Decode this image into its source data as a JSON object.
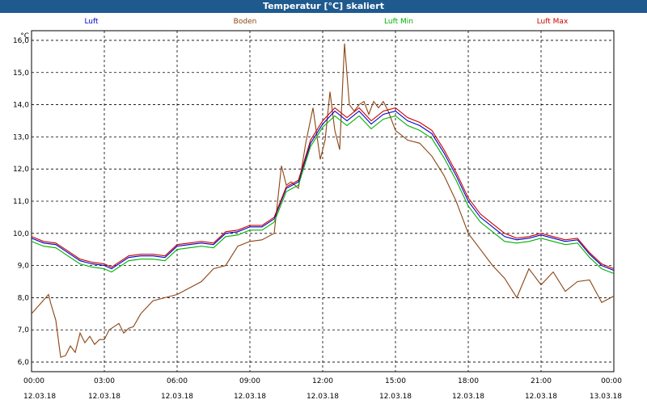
{
  "window": {
    "title": "Temperatur [°C] skaliert"
  },
  "chart_data": {
    "type": "line",
    "title": "Temperatur [°C] skaliert",
    "ylabel": "°C",
    "xlabel": "",
    "ylim": [
      5.7,
      16.3
    ],
    "xlim_hours": [
      0,
      24
    ],
    "y_ticks": [
      "6,0",
      "7,0",
      "8,0",
      "9,0",
      "10,0",
      "11,0",
      "12,0",
      "13,0",
      "14,0",
      "15,0",
      "16,0"
    ],
    "y_tick_values": [
      6,
      7,
      8,
      9,
      10,
      11,
      12,
      13,
      14,
      15,
      16
    ],
    "x_ticks": [
      {
        "time": "00:00",
        "date": "12.03.18"
      },
      {
        "time": "03:00",
        "date": "12.03.18"
      },
      {
        "time": "06:00",
        "date": "12.03.18"
      },
      {
        "time": "09:00",
        "date": "12.03.18"
      },
      {
        "time": "12:00",
        "date": "12.03.18"
      },
      {
        "time": "15:00",
        "date": "12.03.18"
      },
      {
        "time": "18:00",
        "date": "12.03.18"
      },
      {
        "time": "21:00",
        "date": "12.03.18"
      },
      {
        "time": "00:00",
        "date": "13.03.18"
      }
    ],
    "grid": true,
    "legend_position": "top",
    "series": [
      {
        "name": "Luft",
        "color": "#0000cc",
        "x": [
          0,
          0.5,
          1,
          1.5,
          2,
          2.5,
          3,
          3.3,
          3.5,
          4,
          4.5,
          5,
          5.5,
          6,
          6.5,
          7,
          7.5,
          8,
          8.5,
          9,
          9.5,
          10,
          10.5,
          11,
          11.5,
          12,
          12.5,
          13,
          13.5,
          14,
          14.5,
          15,
          15.5,
          16,
          16.5,
          17,
          17.5,
          18,
          18.5,
          19,
          19.5,
          20,
          20.5,
          21,
          21.5,
          22,
          22.5,
          23,
          23.5,
          24
        ],
        "y": [
          9.85,
          9.7,
          9.65,
          9.4,
          9.15,
          9.05,
          9.0,
          8.9,
          9.0,
          9.25,
          9.3,
          9.3,
          9.25,
          9.6,
          9.65,
          9.7,
          9.65,
          10.0,
          10.05,
          10.2,
          10.2,
          10.45,
          11.4,
          11.6,
          12.8,
          13.4,
          13.8,
          13.5,
          13.8,
          13.4,
          13.7,
          13.8,
          13.5,
          13.35,
          13.1,
          12.5,
          11.8,
          11.0,
          10.5,
          10.2,
          9.9,
          9.8,
          9.85,
          9.95,
          9.85,
          9.75,
          9.8,
          9.35,
          9.0,
          8.85
        ]
      },
      {
        "name": "Boden",
        "color": "#8b4513",
        "x": [
          0,
          0.7,
          0.8,
          1.0,
          1.2,
          1.4,
          1.6,
          1.8,
          2.0,
          2.2,
          2.4,
          2.6,
          2.8,
          3.0,
          3.2,
          3.4,
          3.6,
          3.8,
          4.0,
          4.2,
          4.5,
          5,
          5.5,
          6,
          6.5,
          7,
          7.5,
          8,
          8.5,
          9,
          9.5,
          10,
          10.3,
          10.5,
          10.7,
          11,
          11.3,
          11.6,
          11.9,
          12.1,
          12.3,
          12.5,
          12.7,
          12.9,
          13.1,
          13.3,
          13.5,
          13.7,
          13.9,
          14.1,
          14.3,
          14.5,
          14.7,
          15,
          15.5,
          16,
          16.5,
          17,
          17.5,
          18,
          18.5,
          19,
          19.5,
          20,
          20.5,
          21,
          21.5,
          22,
          22.5,
          23,
          23.5,
          24
        ],
        "y": [
          7.5,
          8.1,
          7.8,
          7.3,
          6.15,
          6.2,
          6.5,
          6.3,
          6.9,
          6.6,
          6.8,
          6.55,
          6.7,
          6.7,
          7.0,
          7.1,
          7.2,
          6.9,
          7.05,
          7.1,
          7.5,
          7.9,
          8.0,
          8.1,
          8.3,
          8.5,
          8.9,
          9.0,
          9.6,
          9.75,
          9.8,
          10.0,
          12.1,
          11.5,
          11.6,
          11.4,
          12.8,
          13.9,
          12.3,
          12.9,
          14.4,
          13.2,
          12.6,
          15.9,
          14.0,
          13.8,
          14.0,
          14.1,
          13.7,
          14.1,
          13.9,
          14.1,
          13.8,
          13.2,
          12.9,
          12.8,
          12.4,
          11.8,
          11.0,
          10.0,
          9.5,
          9.0,
          8.6,
          8.0,
          8.9,
          8.4,
          8.8,
          8.2,
          8.5,
          8.55,
          7.85,
          8.05
        ]
      },
      {
        "name": "Luft Min",
        "color": "#00b000",
        "x": [
          0,
          0.5,
          1,
          1.5,
          2,
          2.5,
          3,
          3.3,
          3.5,
          4,
          4.5,
          5,
          5.5,
          6,
          6.5,
          7,
          7.5,
          8,
          8.5,
          9,
          9.5,
          10,
          10.5,
          11,
          11.5,
          12,
          12.5,
          13,
          13.5,
          14,
          14.5,
          15,
          15.5,
          16,
          16.5,
          17,
          17.5,
          18,
          18.5,
          19,
          19.5,
          20,
          20.5,
          21,
          21.5,
          22,
          22.5,
          23,
          23.5,
          24
        ],
        "y": [
          9.75,
          9.6,
          9.55,
          9.3,
          9.05,
          8.95,
          8.9,
          8.8,
          8.9,
          9.15,
          9.2,
          9.2,
          9.15,
          9.5,
          9.55,
          9.6,
          9.55,
          9.9,
          9.95,
          10.1,
          10.1,
          10.35,
          11.3,
          11.5,
          12.7,
          13.3,
          13.65,
          13.35,
          13.65,
          13.25,
          13.55,
          13.65,
          13.35,
          13.2,
          12.95,
          12.35,
          11.65,
          10.85,
          10.35,
          10.05,
          9.75,
          9.7,
          9.75,
          9.85,
          9.75,
          9.65,
          9.7,
          9.25,
          8.9,
          8.75
        ]
      },
      {
        "name": "Luft Max",
        "color": "#cc0000",
        "x": [
          0,
          0.5,
          1,
          1.5,
          2,
          2.5,
          3,
          3.3,
          3.5,
          4,
          4.5,
          5,
          5.5,
          6,
          6.5,
          7,
          7.5,
          8,
          8.5,
          9,
          9.5,
          10,
          10.5,
          11,
          11.5,
          12,
          12.5,
          13,
          13.5,
          14,
          14.5,
          15,
          15.5,
          16,
          16.5,
          17,
          17.5,
          18,
          18.5,
          19,
          19.5,
          20,
          20.5,
          21,
          21.5,
          22,
          22.5,
          23,
          23.5,
          24
        ],
        "y": [
          9.9,
          9.75,
          9.7,
          9.45,
          9.2,
          9.1,
          9.05,
          8.95,
          9.05,
          9.3,
          9.35,
          9.35,
          9.3,
          9.65,
          9.7,
          9.75,
          9.7,
          10.05,
          10.1,
          10.25,
          10.25,
          10.5,
          11.45,
          11.65,
          12.9,
          13.5,
          13.9,
          13.6,
          13.9,
          13.5,
          13.8,
          13.9,
          13.6,
          13.45,
          13.2,
          12.6,
          11.9,
          11.1,
          10.6,
          10.3,
          10.0,
          9.85,
          9.9,
          10.0,
          9.9,
          9.8,
          9.85,
          9.4,
          9.05,
          8.9
        ]
      }
    ]
  }
}
